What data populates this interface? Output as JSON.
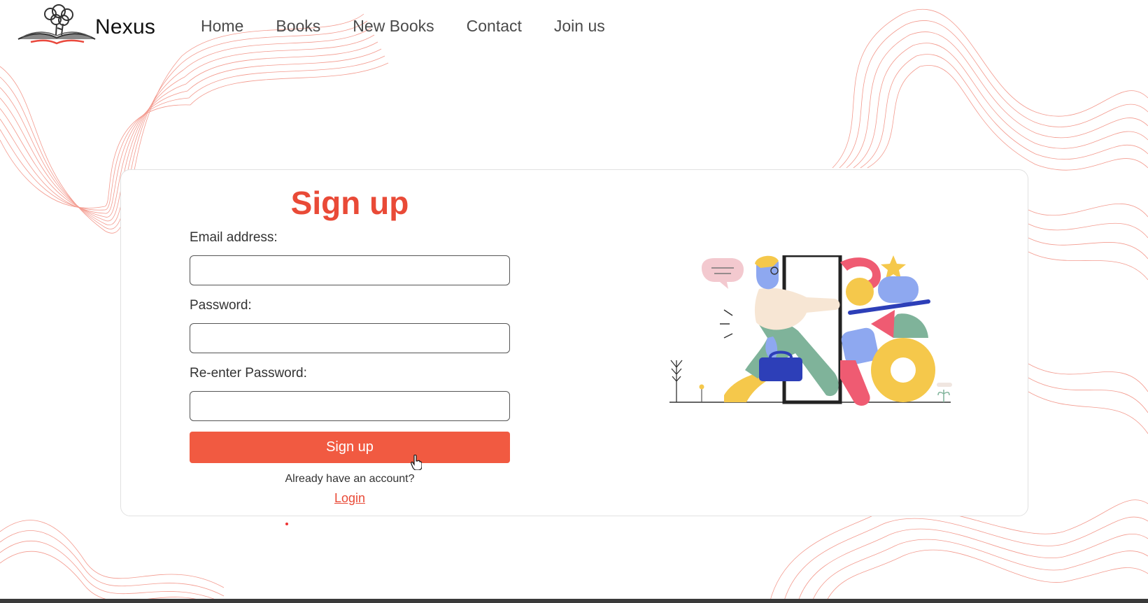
{
  "brand": {
    "name": "Nexus"
  },
  "nav": {
    "items": [
      {
        "label": "Home"
      },
      {
        "label": "Books"
      },
      {
        "label": "New Books"
      },
      {
        "label": "Contact"
      },
      {
        "label": "Join us"
      }
    ]
  },
  "signup": {
    "title": "Sign up",
    "email_label": "Email address:",
    "email_value": "",
    "password_label": "Password:",
    "password_value": "",
    "reenter_label": "Re-enter Password:",
    "reenter_value": "",
    "submit_label": "Sign up",
    "prompt": "Already have an account?",
    "login_link": "Login"
  },
  "colors": {
    "accent": "#f15a41",
    "title": "#e94a37",
    "waves": "#f1887a"
  },
  "icons": [
    "book-tree-logo-icon",
    "hand-pointer-icon",
    "person-door-shapes-illustration"
  ]
}
